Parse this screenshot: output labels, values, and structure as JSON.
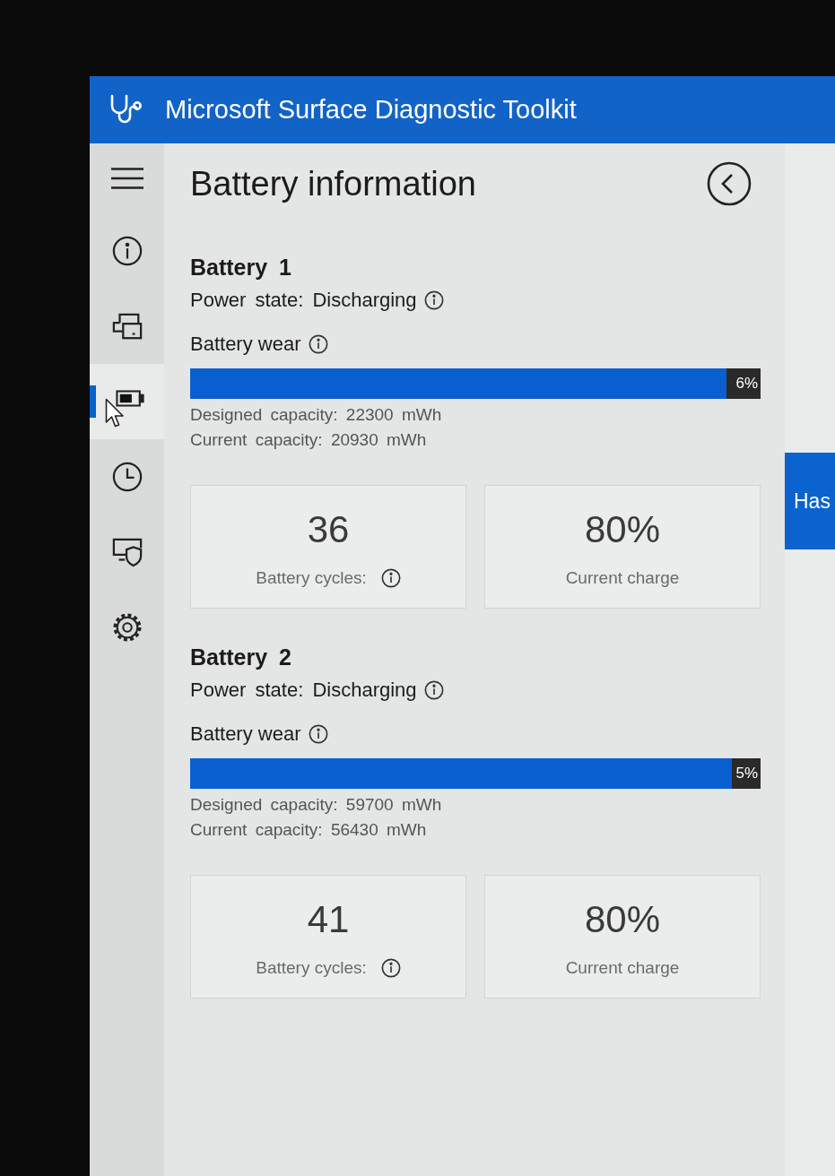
{
  "window": {
    "title": "Microsoft Surface Diagnostic Toolkit"
  },
  "nav": {
    "items": [
      {
        "kind": "info",
        "selected": false,
        "hovered": false
      },
      {
        "kind": "devices",
        "selected": false,
        "hovered": false
      },
      {
        "kind": "battery",
        "selected": true,
        "hovered": true
      },
      {
        "kind": "history",
        "selected": false,
        "hovered": false
      },
      {
        "kind": "security",
        "selected": false,
        "hovered": false
      },
      {
        "kind": "settings",
        "selected": false,
        "hovered": false
      }
    ]
  },
  "page": {
    "title": "Battery information"
  },
  "batteries": [
    {
      "heading": "Battery 1",
      "power_state": "Power state: Discharging",
      "wear_label": "Battery wear",
      "wear": {
        "level": 0.06,
        "reading": "6%"
      },
      "designed_capacity": "Designed capacity: 22300 mWh",
      "current_capacity": "Current capacity: 20930 mWh",
      "cards": [
        {
          "value": "36",
          "label": "Battery cycles:",
          "info": true
        },
        {
          "value": "80%",
          "label": "Current charge",
          "info": false
        }
      ]
    },
    {
      "heading": "Battery 2",
      "power_state": "Power state: Discharging",
      "wear_label": "Battery wear",
      "wear": {
        "level": 0.05,
        "reading": "5%"
      },
      "designed_capacity": "Designed capacity: 59700 mWh",
      "current_capacity": "Current capacity: 56430 mWh",
      "cards": [
        {
          "value": "41",
          "label": "Battery cycles:",
          "info": true
        },
        {
          "value": "80%",
          "label": "Current charge",
          "info": false
        }
      ]
    }
  ],
  "side_tile": {
    "label": "Has"
  }
}
